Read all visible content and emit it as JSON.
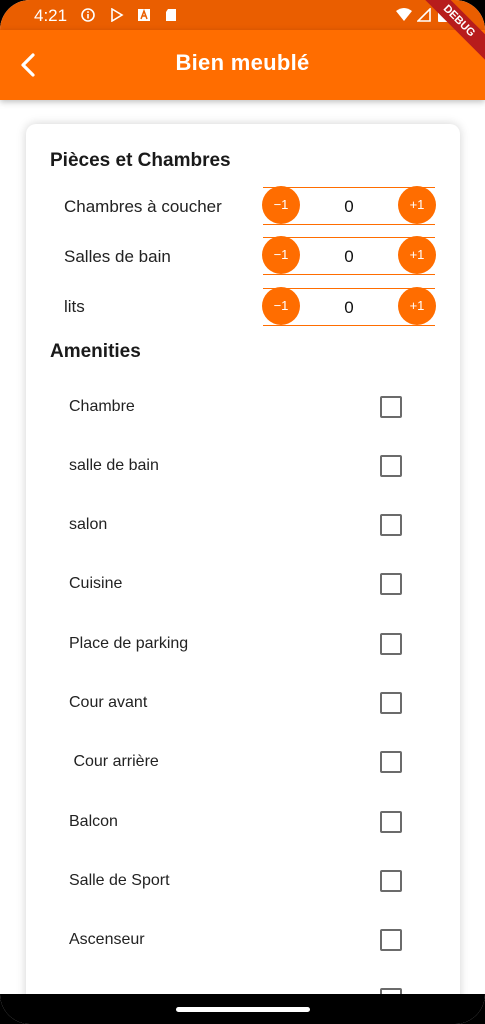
{
  "status_bar": {
    "time": "4:21"
  },
  "app_bar": {
    "title": "Bien meublé",
    "debug_label": "DEBUG"
  },
  "rooms_section": {
    "title": "Pièces et Chambres",
    "counters": [
      {
        "label": "Chambres à coucher",
        "value": "0",
        "minus_label": "−1",
        "plus_label": "+1"
      },
      {
        "label": "Salles de bain",
        "value": "0",
        "minus_label": "−1",
        "plus_label": "+1"
      },
      {
        "label": "lits",
        "value": "0",
        "minus_label": "−1",
        "plus_label": "+1"
      }
    ]
  },
  "amenities_section": {
    "title": "Amenities",
    "items": [
      {
        "label": "Chambre",
        "checked": false
      },
      {
        "label": "salle de bain",
        "checked": false
      },
      {
        "label": "salon",
        "checked": false
      },
      {
        "label": "Cuisine",
        "checked": false
      },
      {
        "label": "Place de parking",
        "checked": false
      },
      {
        "label": "Cour avant",
        "checked": false
      },
      {
        "label": " Cour arrière",
        "checked": false
      },
      {
        "label": "Balcon",
        "checked": false
      },
      {
        "label": "Salle de Sport",
        "checked": false
      },
      {
        "label": "Ascenseur",
        "checked": false
      }
    ]
  },
  "colors": {
    "primary": "#ff6d00",
    "status_bar": "#ea5e00"
  }
}
